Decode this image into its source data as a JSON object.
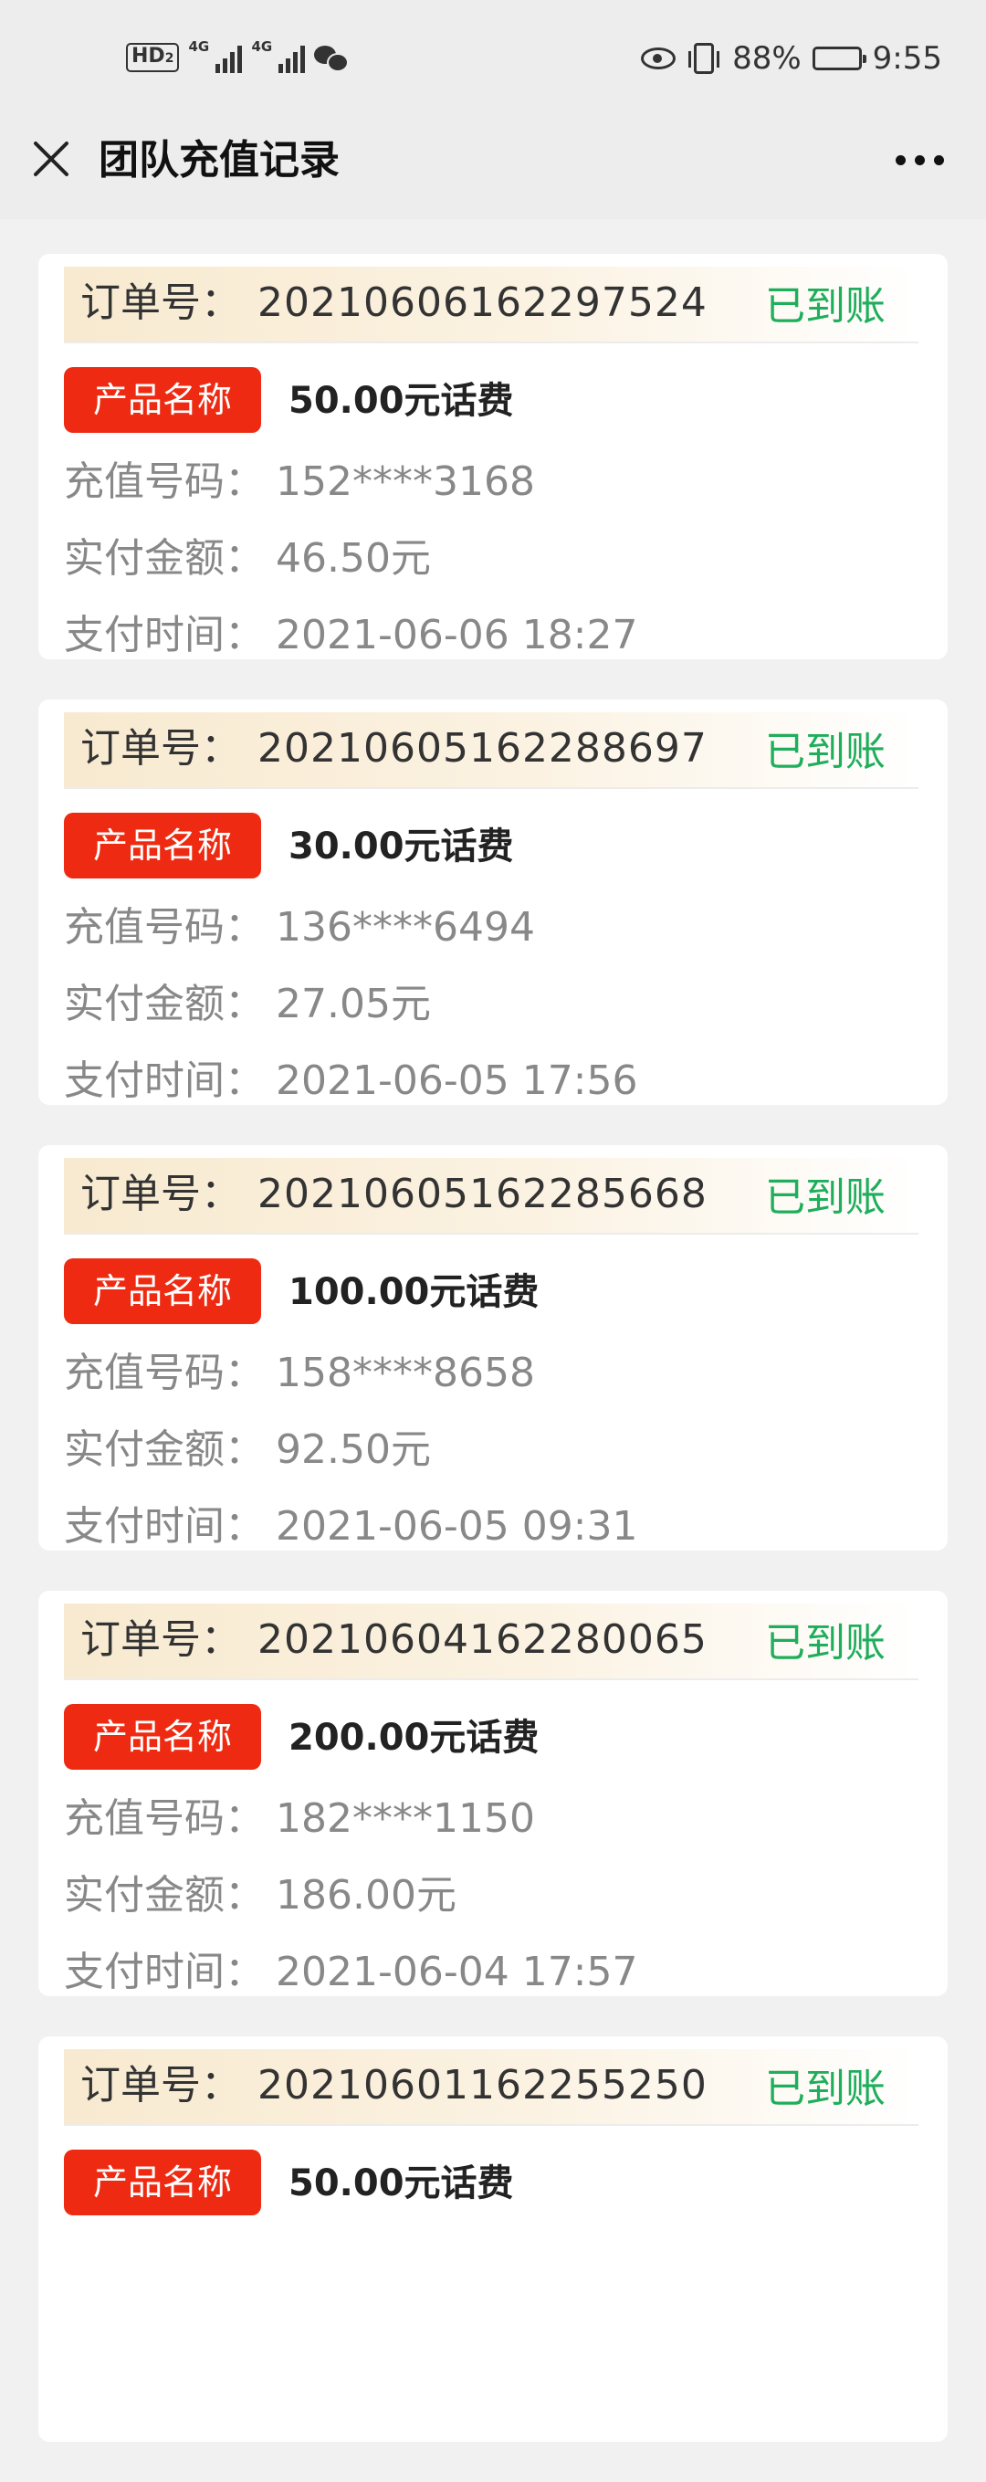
{
  "status_bar": {
    "hd_label": "HD",
    "hd_sub": "2",
    "signal1_label": "4G",
    "signal2_label": "4G",
    "battery_percent": "88%",
    "battery_level": 0.88,
    "time": "9:55"
  },
  "nav": {
    "title": "团队充值记录"
  },
  "labels": {
    "order_no": "订单号：",
    "product_tag": "产品名称",
    "phone": "充值号码：",
    "paid": "实付金额：",
    "pay_time": "支付时间："
  },
  "orders": [
    {
      "order_no": "20210606162297524",
      "status": "已到账",
      "product": "50.00元话费",
      "phone": "152****3168",
      "paid": "46.50元",
      "pay_time": "2021-06-06 18:27"
    },
    {
      "order_no": "20210605162288697",
      "status": "已到账",
      "product": "30.00元话费",
      "phone": "136****6494",
      "paid": "27.05元",
      "pay_time": "2021-06-05 17:56"
    },
    {
      "order_no": "20210605162285668",
      "status": "已到账",
      "product": "100.00元话费",
      "phone": "158****8658",
      "paid": "92.50元",
      "pay_time": "2021-06-05 09:31"
    },
    {
      "order_no": "20210604162280065",
      "status": "已到账",
      "product": "200.00元话费",
      "phone": "182****1150",
      "paid": "186.00元",
      "pay_time": "2021-06-04 17:57"
    },
    {
      "order_no": "20210601162255250",
      "status": "已到账",
      "product": "50.00元话费",
      "phone": "",
      "paid": "",
      "pay_time": ""
    }
  ],
  "colors": {
    "status_green": "#1fae5b",
    "tag_red": "#ee2b12",
    "header_gradient": "#f8ead0"
  }
}
